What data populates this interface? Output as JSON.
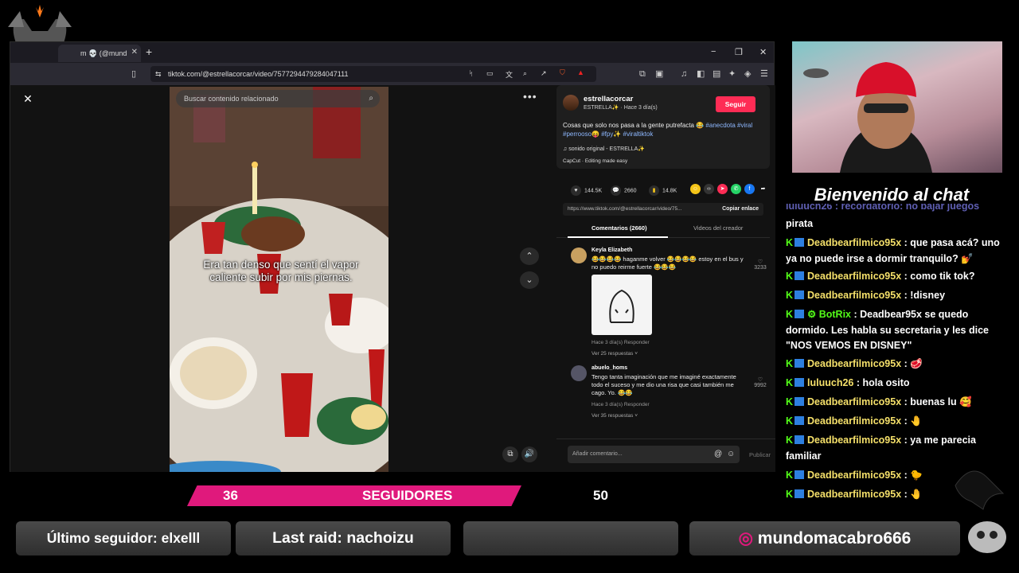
{
  "browser": {
    "tab_title": "m 💀 (@mund",
    "url": "tiktok.com/@estrellacorcar/video/7577294479284047111",
    "window_controls": [
      "−",
      "❐",
      "✕"
    ]
  },
  "video": {
    "search_placeholder": "Buscar contenido relacionado",
    "caption": "Era tan denso que sentí el vapor caliente subir por mis piernas."
  },
  "panel": {
    "author_name": "estrellacorcar",
    "author_sub": "ESTRELLA✨ · Hace 3 día(s)",
    "follow_label": "Seguir",
    "description": "Cosas que solo nos pasa a la gente putrefacta 😂",
    "hashtags": [
      "#anecdota",
      "#viral",
      "#perrooso😝",
      "#fpy✨",
      "#viraltiktok"
    ],
    "sound": "♫ sonido original - ESTRELLA✨",
    "capcut": "CapCut · Editing made easy",
    "likes": "144.5K",
    "comments_count": "2660",
    "saves": "14.8K",
    "link_url": "https://www.tiktok.com/@estrellacorcar/video/75...",
    "copy_link": "Copiar enlace",
    "tab_comments": "Comentarios (2660)",
    "tab_creator": "Videos del creador",
    "comments": [
      {
        "user": "Keyla Elizabeth",
        "text": "😂😂😂😂 haganme volver 😂😂😂😂 estoy en el bus y no puedo reirme fuerte 😂😂😂",
        "meta": "Hace 3 día(s)    Responder",
        "replies": "Ver 25 respuestas ˅",
        "likes": "3233"
      },
      {
        "user": "abuelo_homs",
        "text": "Tengo tanta imaginación que me imaginé exactamente todo el suceso y me dio una risa que casi también me cago. Yo. 😂😂",
        "meta": "Hace 3 día(s)    Responder",
        "replies": "Ver 35 respuestas ˅",
        "likes": "9992"
      }
    ],
    "comment_placeholder": "Añadir comentario...",
    "publish": "Publicar"
  },
  "stream": {
    "welcome": "Bienvenido al chat",
    "chat": [
      {
        "user": "",
        "msg": "pirata",
        "partial_top": "luluuch26 : recordatorio: no bajar juegos"
      },
      {
        "user": "Deadbearfilmico95x",
        "msg": ": que pasa acá? uno ya no puede irse a dormir tranquilo? 💅"
      },
      {
        "user": "Deadbearfilmico95x",
        "msg": ": como tik tok?"
      },
      {
        "user": "Deadbearfilmico95x",
        "msg": ": !disney"
      },
      {
        "user": "BotRix",
        "msg": ": Deadbear95x se quedo dormido. Les habla su secretaria y les dice \"NOS VEMOS EN DISNEY\""
      },
      {
        "user": "Deadbearfilmico95x",
        "msg": ": 🥩"
      },
      {
        "user": "luluuch26",
        "msg": ": hola osito"
      },
      {
        "user": "Deadbearfilmico95x",
        "msg": ": buenas lu 🥰"
      },
      {
        "user": "Deadbearfilmico95x",
        "msg": ": 🤚"
      },
      {
        "user": "Deadbearfilmico95x",
        "msg": ": ya me parecia familiar"
      },
      {
        "user": "Deadbearfilmico95x",
        "msg": ": 🐤"
      },
      {
        "user": "Deadbearfilmico95x",
        "msg": ": 🤚"
      }
    ],
    "followers_current": "36",
    "followers_label": "SEGUIDORES",
    "followers_goal": "50",
    "last_follower": "Último seguidor: elxelll",
    "last_raid": "Last raid: nachoizu",
    "instagram": "mundomacabro666"
  },
  "colors": {
    "tiktok_red": "#fe2c55",
    "followers_bar": "#e0197c",
    "chat_user": "#f5e06a",
    "kick_green": "#53fc18"
  }
}
